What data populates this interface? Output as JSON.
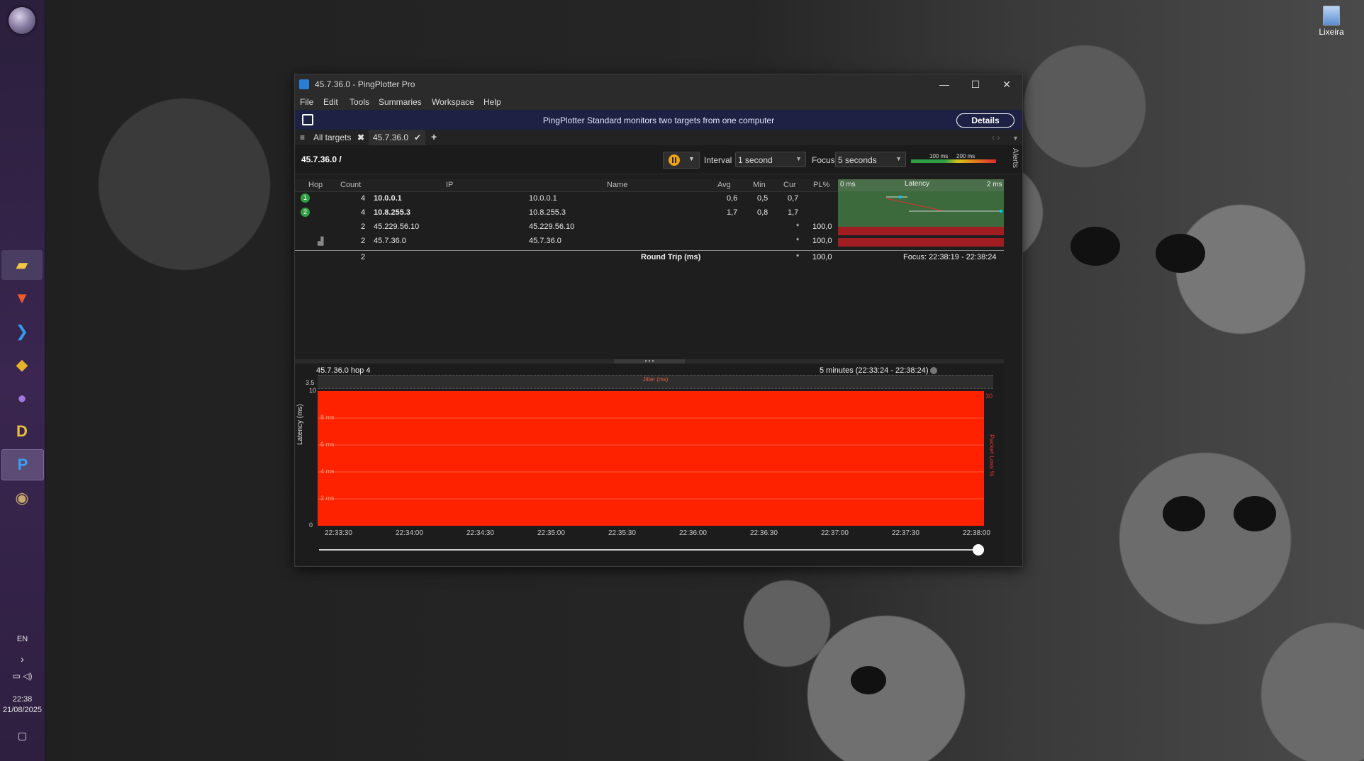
{
  "desktop": {
    "recycle_bin_label": "Lixeira",
    "taskbar": {
      "language": "EN",
      "time": "22:38",
      "date": "21/08/2025",
      "apps": [
        {
          "name": "file-explorer-icon",
          "glyph": "📁"
        },
        {
          "name": "brave-browser-icon",
          "glyph": "🦁"
        },
        {
          "name": "vscode-icon",
          "glyph": "⌘"
        },
        {
          "name": "app-diamond-icon",
          "glyph": "◆"
        },
        {
          "name": "github-icon",
          "glyph": "●"
        },
        {
          "name": "app-d-icon",
          "glyph": "D"
        },
        {
          "name": "pingplotter-icon",
          "glyph": "P"
        },
        {
          "name": "app-globe-icon",
          "glyph": "◉"
        }
      ]
    }
  },
  "window": {
    "title": "45.7.36.0 - PingPlotter Pro",
    "controls": {
      "minimize": "—",
      "maximize": "☐",
      "close": "✕"
    },
    "menu": [
      "File",
      "Edit",
      "Tools",
      "Summaries",
      "Workspace",
      "Help"
    ],
    "banner": {
      "message": "PingPlotter Standard monitors two targets from one computer",
      "details_label": "Details"
    },
    "tabs": {
      "all_targets": "All targets",
      "active_target": "45.7.36.0",
      "add": "+"
    },
    "targetbar": {
      "target": "45.7.36.0 /",
      "interval_label": "Interval",
      "interval_value": "1 second",
      "focus_label": "Focus",
      "focus_value": "5 seconds",
      "scale_left": "100 ms",
      "scale_right": "200 ms",
      "alerts": "Alerts"
    },
    "table": {
      "headers": {
        "hop": "Hop",
        "count": "Count",
        "ip": "IP",
        "name": "Name",
        "avg": "Avg",
        "min": "Min",
        "cur": "Cur",
        "pl": "PL%",
        "latency_left": "0 ms",
        "latency": "Latency",
        "latency_right": "2 ms"
      },
      "rows": [
        {
          "hop": "1",
          "count": "4",
          "ip": "10.0.0.1",
          "name": "10.0.0.1",
          "avg": "0,6",
          "min": "0,5",
          "cur": "0,7",
          "pl": ""
        },
        {
          "hop": "2",
          "count": "4",
          "ip": "10.8.255.3",
          "name": "10.8.255.3",
          "avg": "1,7",
          "min": "0,8",
          "cur": "1,7",
          "pl": ""
        },
        {
          "hop": "",
          "count": "2",
          "ip": "45.229.56.10",
          "name": "45.229.56.10",
          "avg": "",
          "min": "",
          "cur": "*",
          "pl": "100,0"
        },
        {
          "hop": "",
          "count": "2",
          "ip": "45.7.36.0",
          "name": "45.7.36.0",
          "avg": "",
          "min": "",
          "cur": "*",
          "pl": "100,0"
        }
      ],
      "total": {
        "count": "2",
        "label": "Round Trip (ms)",
        "cur": "*",
        "pl": "100,0",
        "focus": "Focus: 22:38:19 - 22:38:24"
      }
    },
    "chart_panel": {
      "title": "45.7.36.0 hop 4",
      "range": "5 minutes (22:33:24 - 22:38:24)",
      "jitter_label": "Jitter (ms)",
      "y_axis_label": "Latency (ms)",
      "y2_axis_label": "Packet Loss %",
      "jitter_tick": "3.5"
    }
  },
  "chart_data": {
    "type": "area",
    "title": "",
    "xlabel": "",
    "ylabel": "Latency (ms)",
    "y2label": "Packet Loss %",
    "ylim": [
      0,
      10
    ],
    "y_ticks": [
      "0",
      "2 ms",
      "4 ms",
      "6 ms",
      "8 ms",
      "10"
    ],
    "x_ticks": [
      "22:33:30",
      "22:34:00",
      "22:34:30",
      "22:35:00",
      "22:35:30",
      "22:36:00",
      "22:36:30",
      "22:37:00",
      "22:37:30",
      "22:38:00"
    ],
    "series": [
      {
        "name": "Packet Loss %",
        "color": "#ff2200",
        "values": [
          100,
          100,
          100,
          100,
          100,
          100,
          100,
          100,
          100,
          100
        ]
      }
    ],
    "right_axis_top": "30"
  }
}
